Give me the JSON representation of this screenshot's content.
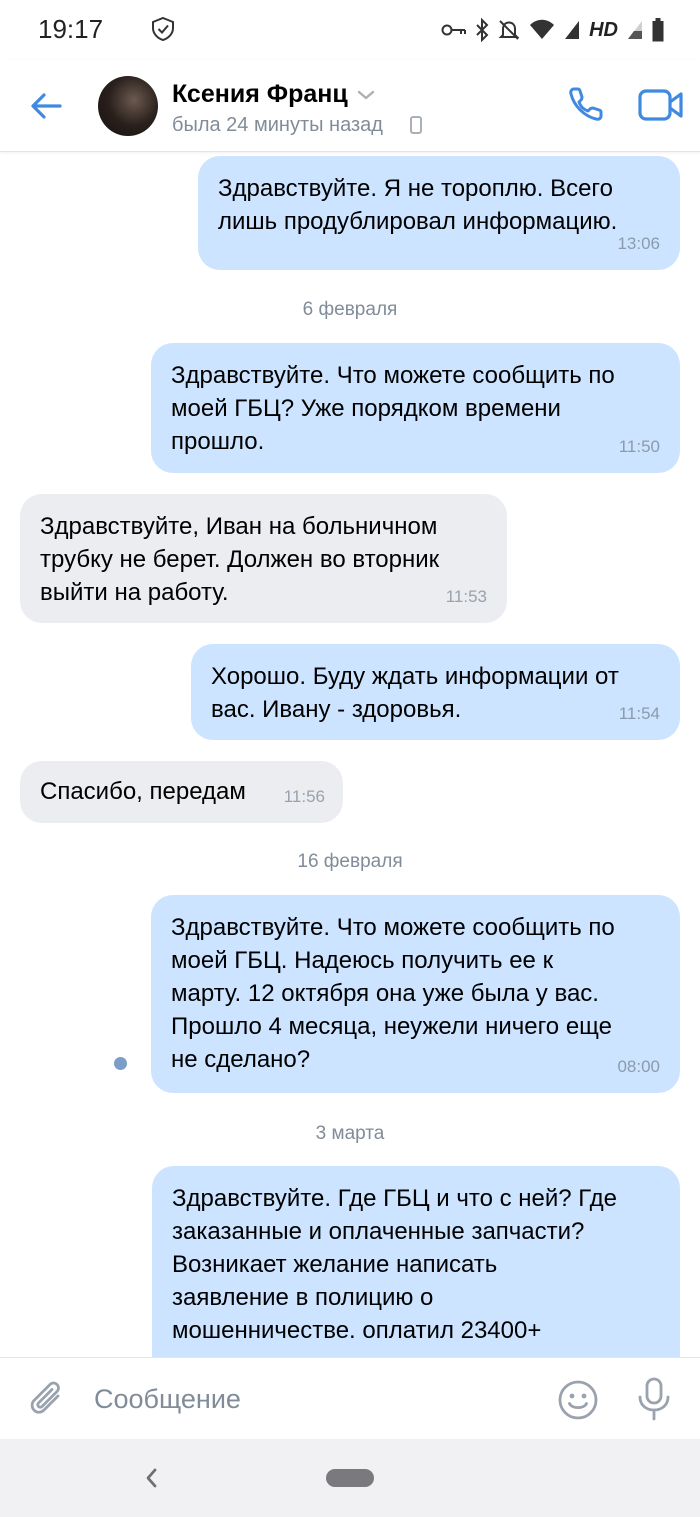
{
  "status_bar": {
    "time": "19:17",
    "hd_label": "HD",
    "icons": [
      "shield-icon",
      "key-icon",
      "bluetooth-icon",
      "bell-off-icon",
      "wifi-icon",
      "signal-icon",
      "signal-empty-icon",
      "battery-icon"
    ]
  },
  "header": {
    "contact_name": "Ксения Франц",
    "contact_status": "была 24 минуты назад"
  },
  "messages": [
    {
      "dir": "out",
      "text": "Здравствуйте. Я не тороплю. Всего\nлишь продублировал информацию.",
      "time": "13:06"
    },
    {
      "date": "6 февраля"
    },
    {
      "dir": "out",
      "text": "Здравствуйте. Что можете сообщить по\nмоей ГБЦ? Уже порядком времени\nпрошло.",
      "time": "11:50"
    },
    {
      "dir": "in",
      "text": "Здравствуйте, Иван на больничном\nтрубку не берет. Должен во вторник\nвыйти на работу.",
      "time": "11:53"
    },
    {
      "dir": "out",
      "text": "Хорошо. Буду ждать информации от\nвас. Ивану -  здоровья.",
      "time": "11:54"
    },
    {
      "dir": "in",
      "text": "Спасибо, передам",
      "time": "11:56"
    },
    {
      "date": "16 февраля"
    },
    {
      "dir": "out",
      "text": "Здравствуйте. Что можете сообщить по\nмоей ГБЦ. Надеюсь получить ее к\nмарту. 12 октября она уже была у вас.\nПрошло 4 месяца, неужели ничего еще\nне сделано?",
      "time": "08:00",
      "unread": true
    },
    {
      "date": "3 марта"
    },
    {
      "dir": "out",
      "text": "Здравствуйте. Где ГБЦ и что с ней? Где\nзаказанные и оплаченные запчасти?\nВозникает желание написать\nзаявление в полицию о\nмошенничестве. оплатил 23400+",
      "time": ""
    }
  ],
  "composer": {
    "placeholder": "Сообщение"
  },
  "colors": {
    "accent": "#3f8ae0",
    "outgoing_bubble": "#cce4ff",
    "incoming_bubble": "#ebedf0",
    "secondary_text": "#818c99"
  }
}
